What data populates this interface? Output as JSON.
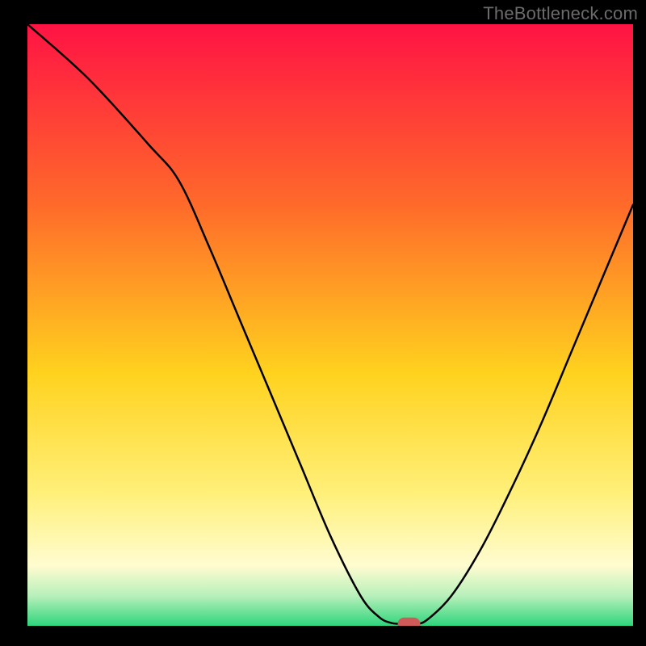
{
  "watermark": "TheBottleneck.com",
  "colors": {
    "black": "#000000",
    "watermark": "#6b6b6b",
    "grad_top": "#ff1344",
    "grad_mid1": "#ff6a2a",
    "grad_mid2": "#ffd21e",
    "grad_mid3": "#fff07a",
    "grad_mid4": "#fffcd0",
    "grad_green_pale": "#b8f0bb",
    "grad_green": "#2ed57c",
    "marker": "#cf5a5a",
    "curve": "#000000"
  },
  "chart_data": {
    "type": "line",
    "title": "",
    "xlabel": "",
    "ylabel": "",
    "xlim": [
      0,
      100
    ],
    "ylim": [
      0,
      100
    ],
    "grid": false,
    "legend": false,
    "series": [
      {
        "name": "bottleneck-curve",
        "x": [
          0,
          10,
          20,
          25,
          30,
          35,
          40,
          45,
          50,
          55,
          58,
          60,
          62,
          64,
          66,
          70,
          75,
          80,
          85,
          90,
          95,
          100
        ],
        "values": [
          100,
          91,
          80,
          74,
          63,
          51,
          39,
          27,
          15,
          5,
          1.5,
          0.5,
          0.3,
          0.3,
          1,
          5,
          13,
          23,
          34,
          46,
          58,
          70
        ]
      }
    ],
    "marker": {
      "x": 63,
      "y": 0.3,
      "label": "optimal-point"
    },
    "gradient_bands": [
      {
        "from": 100,
        "to": 35,
        "color_role": "red-orange"
      },
      {
        "from": 35,
        "to": 12,
        "color_role": "orange-yellow"
      },
      {
        "from": 12,
        "to": 4,
        "color_role": "pale-yellow"
      },
      {
        "from": 4,
        "to": 2,
        "color_role": "pale-green"
      },
      {
        "from": 2,
        "to": 0,
        "color_role": "green"
      }
    ]
  }
}
